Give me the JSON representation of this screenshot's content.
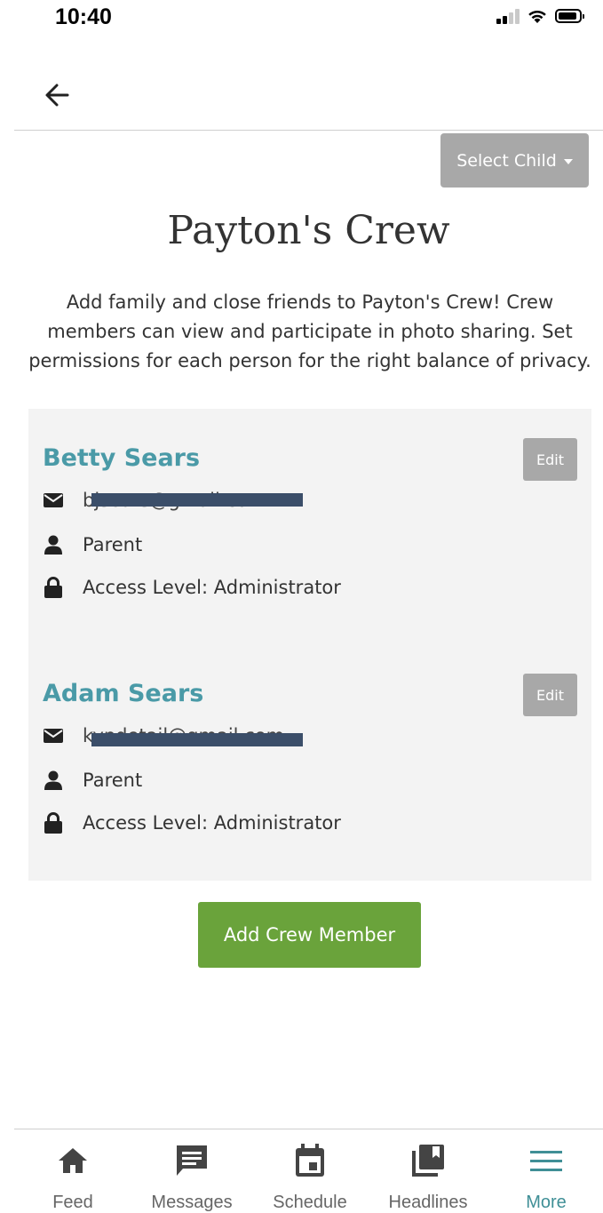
{
  "status_bar": {
    "time": "10:40"
  },
  "header": {
    "select_child_label": "Select Child"
  },
  "page": {
    "title": "Payton's Crew",
    "intro": "Add family and close friends to Payton's Crew! Crew members can view and participate in photo sharing. Set permissions for each person for the right balance of privacy."
  },
  "members": [
    {
      "name": "Betty Sears",
      "email": "bjsears@gmail.com",
      "role": "Parent",
      "access": "Access Level: Administrator",
      "edit_label": "Edit"
    },
    {
      "name": "Adam Sears",
      "email": "kypdetail@gmail.com",
      "role": "Parent",
      "access": "Access Level: Administrator",
      "edit_label": "Edit"
    }
  ],
  "actions": {
    "add_member_label": "Add Crew Member"
  },
  "tabs": [
    {
      "label": "Feed",
      "icon": "home-icon"
    },
    {
      "label": "Messages",
      "icon": "message-icon"
    },
    {
      "label": "Schedule",
      "icon": "calendar-icon"
    },
    {
      "label": "Headlines",
      "icon": "headlines-icon"
    },
    {
      "label": "More",
      "icon": "menu-icon",
      "active": true
    }
  ],
  "colors": {
    "accent": "#4a9aa7",
    "button_gray": "#a8a8a8",
    "add_green": "#6aa33b",
    "active_tab": "#3f8f96",
    "panel": "#f3f3f3"
  }
}
